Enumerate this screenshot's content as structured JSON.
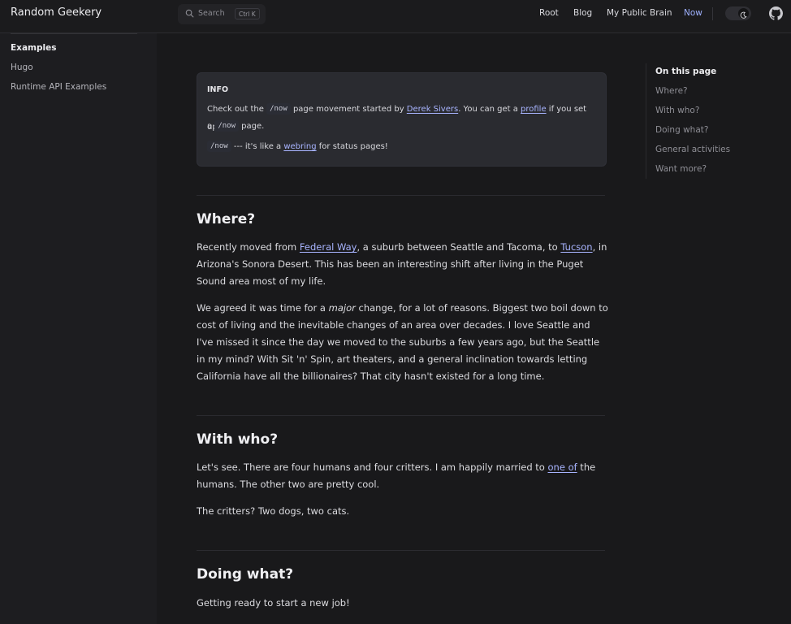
{
  "site": {
    "title": "Random Geekery"
  },
  "search": {
    "placeholder": "Search",
    "shortcut": "Ctrl K"
  },
  "nav": {
    "items": [
      "Root",
      "Blog",
      "My Public Brain",
      "Now"
    ],
    "active": "Now"
  },
  "icons": {
    "search": "search-icon",
    "theme": "moon-icon",
    "github": "github-icon"
  },
  "colors": {
    "accent": "#9fb1ff",
    "link": "#a8b4ff",
    "background": "#19191b"
  },
  "sidebar": {
    "items": [
      {
        "label": "Examples"
      },
      {
        "label": "Hugo"
      },
      {
        "label": "Runtime API Examples"
      }
    ]
  },
  "callout": {
    "title": "INFO",
    "line1": {
      "a": "Check out the ",
      "code": "/now",
      "b": " page movement started by ",
      "link1": "Derek Sivers",
      "c": ". You can get a ",
      "link2": "profile",
      "d": " if you set up"
    },
    "line2": {
      "a": "a ",
      "code": "/now",
      "b": " page."
    },
    "line3": {
      "code": "/now",
      "a": " --- it's like a ",
      "link": "webring",
      "b": " for status pages!"
    }
  },
  "sections": {
    "where": {
      "heading": "Where?",
      "p1": {
        "a": "Recently moved from ",
        "link1": "Federal Way",
        "b": ", a suburb between Seattle and Tacoma, to ",
        "link2": "Tucson",
        "c": ", in Arizona's Sonora Desert. This has been an interesting shift after living in the Puget Sound area most of my life."
      },
      "p2": {
        "a": "We agreed it was time for a ",
        "em": "major",
        "b": " change, for a lot of reasons. Biggest two boil down to cost of living and the inevitable changes of an area over decades. I love Seattle and I've missed it since the day we moved to the suburbs a few years ago, but the Seattle in my mind? With Sit 'n' Spin, art theaters, and a general inclination towards letting California have all the billionaires? That city hasn't existed for a long time."
      }
    },
    "withwho": {
      "heading": "With who?",
      "p1": {
        "a": "Let's see. There are four humans and four critters. I am happily married to ",
        "link": "one of",
        "b": " the humans. The other two are pretty cool."
      },
      "p2": "The critters? Two dogs, two cats."
    },
    "doing": {
      "heading": "Doing what?",
      "p1": "Getting ready to start a new job!"
    }
  },
  "toc": {
    "title": "On this page",
    "items": [
      "Where?",
      "With who?",
      "Doing what?",
      "General activities",
      "Want more?"
    ]
  }
}
